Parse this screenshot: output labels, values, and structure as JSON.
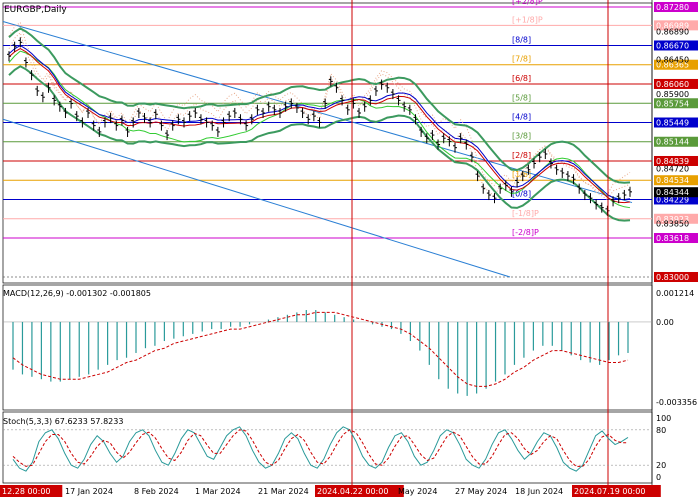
{
  "window": {
    "symbol": "EURGBP,Daily"
  },
  "colors": {
    "price": "#000000",
    "ma_blue": "#0000cc",
    "ma_red": "#cc0000",
    "bands": "#3c9a5f",
    "lime": "#33cc33",
    "channel": "#2a7fd4",
    "ichimoku": "#e8a98a",
    "macd_hist": "#2a9a9a",
    "macd_signal": "#cc0000",
    "stoch_main": "#2a9a9a",
    "stoch_signal": "#cc0000",
    "vline": "#cc0000"
  },
  "chart_data": [
    {
      "type": "line",
      "title": "EURGBP,Daily",
      "ylim": [
        0.83,
        0.8728
      ],
      "x_tick_labels": [
        "12.28 00:00",
        "17 Jan 2024",
        "8 Feb 2024",
        "1 Mar 2024",
        "21 Mar 2024",
        "2024.04.22 00:00",
        "May 2024",
        "27 May 2024",
        "18 Jun 2024",
        "2024.07.19 00:00"
      ],
      "price_levels": [
        {
          "label": "[+2/8]P",
          "value": 0.8728,
          "color": "#cc00cc"
        },
        {
          "label": "[+1/8]P",
          "value": 0.86989,
          "color": "#ffaaaa"
        },
        {
          "label": "[8/8]",
          "value": 0.8667,
          "color": "#0000cc"
        },
        {
          "label": "[7/8]",
          "value": 0.86365,
          "color": "#e8a000"
        },
        {
          "label": "[6/8]",
          "value": 0.8606,
          "color": "#cc0000"
        },
        {
          "label": "[5/8]",
          "value": 0.85754,
          "color": "#5a9a3a"
        },
        {
          "label": "[4/8]",
          "value": 0.85449,
          "color": "#0000cc"
        },
        {
          "label": "[3/8]",
          "value": 0.85144,
          "color": "#5a9a3a"
        },
        {
          "label": "[2/8]",
          "value": 0.84839,
          "color": "#cc0000"
        },
        {
          "label": "[1/8]",
          "value": 0.84534,
          "color": "#e8a000"
        },
        {
          "label": "[0/8]",
          "value": 0.84229,
          "color": "#0000cc"
        },
        {
          "label": "[-1/8]P",
          "value": 0.83923,
          "color": "#ffaaaa"
        },
        {
          "label": "[-2/8]P",
          "value": 0.83618,
          "color": "#cc00cc"
        }
      ],
      "axis_ticks": [
        "0.86890",
        "0.86450",
        "0.85900",
        "0.84720",
        "0.83850",
        "0.83000"
      ],
      "current_price": {
        "label": "0.84344",
        "value": 0.84344
      },
      "series": [
        {
          "values": [
            0.865,
            0.8665,
            0.8672,
            0.864,
            0.862,
            0.8595,
            0.8585,
            0.86,
            0.858,
            0.857,
            0.856,
            0.8575,
            0.8555,
            0.8545,
            0.856,
            0.854,
            0.853,
            0.8545,
            0.8552,
            0.854,
            0.8548,
            0.853,
            0.8545,
            0.856,
            0.8552,
            0.8545,
            0.8558,
            0.854,
            0.8525,
            0.854,
            0.855,
            0.8545,
            0.8555,
            0.856,
            0.855,
            0.8545,
            0.854,
            0.853,
            0.8545,
            0.8555,
            0.856,
            0.855,
            0.854,
            0.855,
            0.8565,
            0.856,
            0.857,
            0.8565,
            0.856,
            0.857,
            0.8575,
            0.8568,
            0.856,
            0.855,
            0.8555,
            0.8545,
            0.8575,
            0.861,
            0.86,
            0.858,
            0.8565,
            0.8575,
            0.856,
            0.857,
            0.858,
            0.8595,
            0.8605,
            0.86,
            0.859,
            0.858,
            0.857,
            0.8565,
            0.855,
            0.853,
            0.852,
            0.8525,
            0.851,
            0.852,
            0.8515,
            0.8505,
            0.852,
            0.851,
            0.849,
            0.846,
            0.844,
            0.843,
            0.8425,
            0.844,
            0.8445,
            0.8435,
            0.845,
            0.846,
            0.847,
            0.848,
            0.849,
            0.8495,
            0.848,
            0.847,
            0.8465,
            0.846,
            0.8455,
            0.844,
            0.843,
            0.8425,
            0.8415,
            0.841,
            0.8405,
            0.842,
            0.8425,
            0.843,
            0.8435
          ]
        }
      ]
    },
    {
      "type": "bar",
      "title": "MACD(12,26,9) -0.001302 -0.001805",
      "ylim": [
        -0.003356,
        0.001214
      ],
      "axis_ticks": [
        "0.001214",
        "0.00",
        "-0.003356"
      ],
      "histogram": [
        -0.002,
        -0.0022,
        -0.0023,
        -0.0024,
        -0.0025,
        -0.0025,
        -0.0024,
        -0.0023,
        -0.0022,
        -0.002,
        -0.0018,
        -0.0016,
        -0.0015,
        -0.0013,
        -0.0011,
        -0.001,
        -0.0008,
        -0.0007,
        -0.0006,
        -0.0005,
        -0.0004,
        -0.0003,
        -0.0003,
        -0.0002,
        -0.0002,
        -0.0001,
        0.0,
        0.0001,
        0.0002,
        0.0003,
        0.0004,
        0.0005,
        0.0005,
        0.0004,
        0.0003,
        0.0002,
        0.0001,
        0.0,
        -0.0001,
        -0.0002,
        -0.0003,
        -0.0005,
        -0.0008,
        -0.0012,
        -0.0018,
        -0.0024,
        -0.0028,
        -0.003,
        -0.0031,
        -0.003,
        -0.0028,
        -0.0025,
        -0.0022,
        -0.0018,
        -0.0015,
        -0.0012,
        -0.001,
        -0.001,
        -0.0012,
        -0.0014,
        -0.0016,
        -0.0017,
        -0.0018,
        -0.0016,
        -0.0014,
        -0.0013
      ],
      "signal": [
        -0.0015,
        -0.0018,
        -0.002,
        -0.0022,
        -0.0023,
        -0.0024,
        -0.0024,
        -0.0024,
        -0.0023,
        -0.0022,
        -0.0021,
        -0.0019,
        -0.0017,
        -0.0016,
        -0.0014,
        -0.0012,
        -0.0011,
        -0.0009,
        -0.0008,
        -0.0007,
        -0.0006,
        -0.0005,
        -0.0004,
        -0.0003,
        -0.0003,
        -0.0002,
        -0.0001,
        0.0,
        0.0001,
        0.0002,
        0.0003,
        0.0003,
        0.0004,
        0.0004,
        0.0004,
        0.0003,
        0.0002,
        0.0001,
        0.0,
        -0.0001,
        -0.0002,
        -0.0003,
        -0.0005,
        -0.0008,
        -0.0011,
        -0.0015,
        -0.0019,
        -0.0023,
        -0.0026,
        -0.0027,
        -0.0027,
        -0.0026,
        -0.0024,
        -0.0021,
        -0.0019,
        -0.0016,
        -0.0014,
        -0.0012,
        -0.0012,
        -0.0013,
        -0.0014,
        -0.0015,
        -0.0016,
        -0.0017,
        -0.0017,
        -0.0016
      ]
    },
    {
      "type": "line",
      "title": "Stoch(5,3,3) 67.6233 57.8233",
      "ylim": [
        0,
        100
      ],
      "axis_ticks": [
        "100",
        "80",
        "20",
        "0"
      ],
      "main": [
        30,
        15,
        10,
        25,
        60,
        75,
        80,
        65,
        40,
        20,
        15,
        30,
        55,
        70,
        60,
        40,
        25,
        35,
        60,
        75,
        80,
        70,
        45,
        25,
        20,
        40,
        65,
        80,
        75,
        55,
        35,
        30,
        50,
        70,
        80,
        85,
        70,
        45,
        25,
        15,
        20,
        40,
        65,
        75,
        65,
        40,
        20,
        15,
        30,
        55,
        75,
        85,
        80,
        60,
        35,
        20,
        15,
        25,
        50,
        70,
        75,
        60,
        35,
        20,
        25,
        45,
        70,
        80,
        75,
        55,
        30,
        20,
        15,
        30,
        55,
        75,
        80,
        65,
        45,
        30,
        40,
        60,
        75,
        70,
        50,
        25,
        15,
        10,
        20,
        45,
        70,
        78,
        65,
        55,
        60,
        67
      ],
      "signal": [
        35,
        25,
        18,
        20,
        40,
        60,
        72,
        72,
        60,
        40,
        25,
        22,
        35,
        52,
        62,
        58,
        42,
        32,
        42,
        58,
        72,
        76,
        66,
        48,
        32,
        28,
        42,
        62,
        74,
        70,
        54,
        40,
        40,
        55,
        70,
        80,
        78,
        62,
        42,
        25,
        20,
        28,
        48,
        65,
        72,
        62,
        42,
        25,
        22,
        35,
        55,
        72,
        80,
        75,
        58,
        38,
        22,
        20,
        32,
        52,
        68,
        70,
        55,
        38,
        28,
        32,
        50,
        68,
        76,
        70,
        52,
        34,
        22,
        22,
        35,
        55,
        72,
        75,
        65,
        48,
        38,
        45,
        60,
        70,
        65,
        45,
        28,
        18,
        18,
        30,
        52,
        68,
        72,
        62,
        58,
        58
      ]
    }
  ]
}
